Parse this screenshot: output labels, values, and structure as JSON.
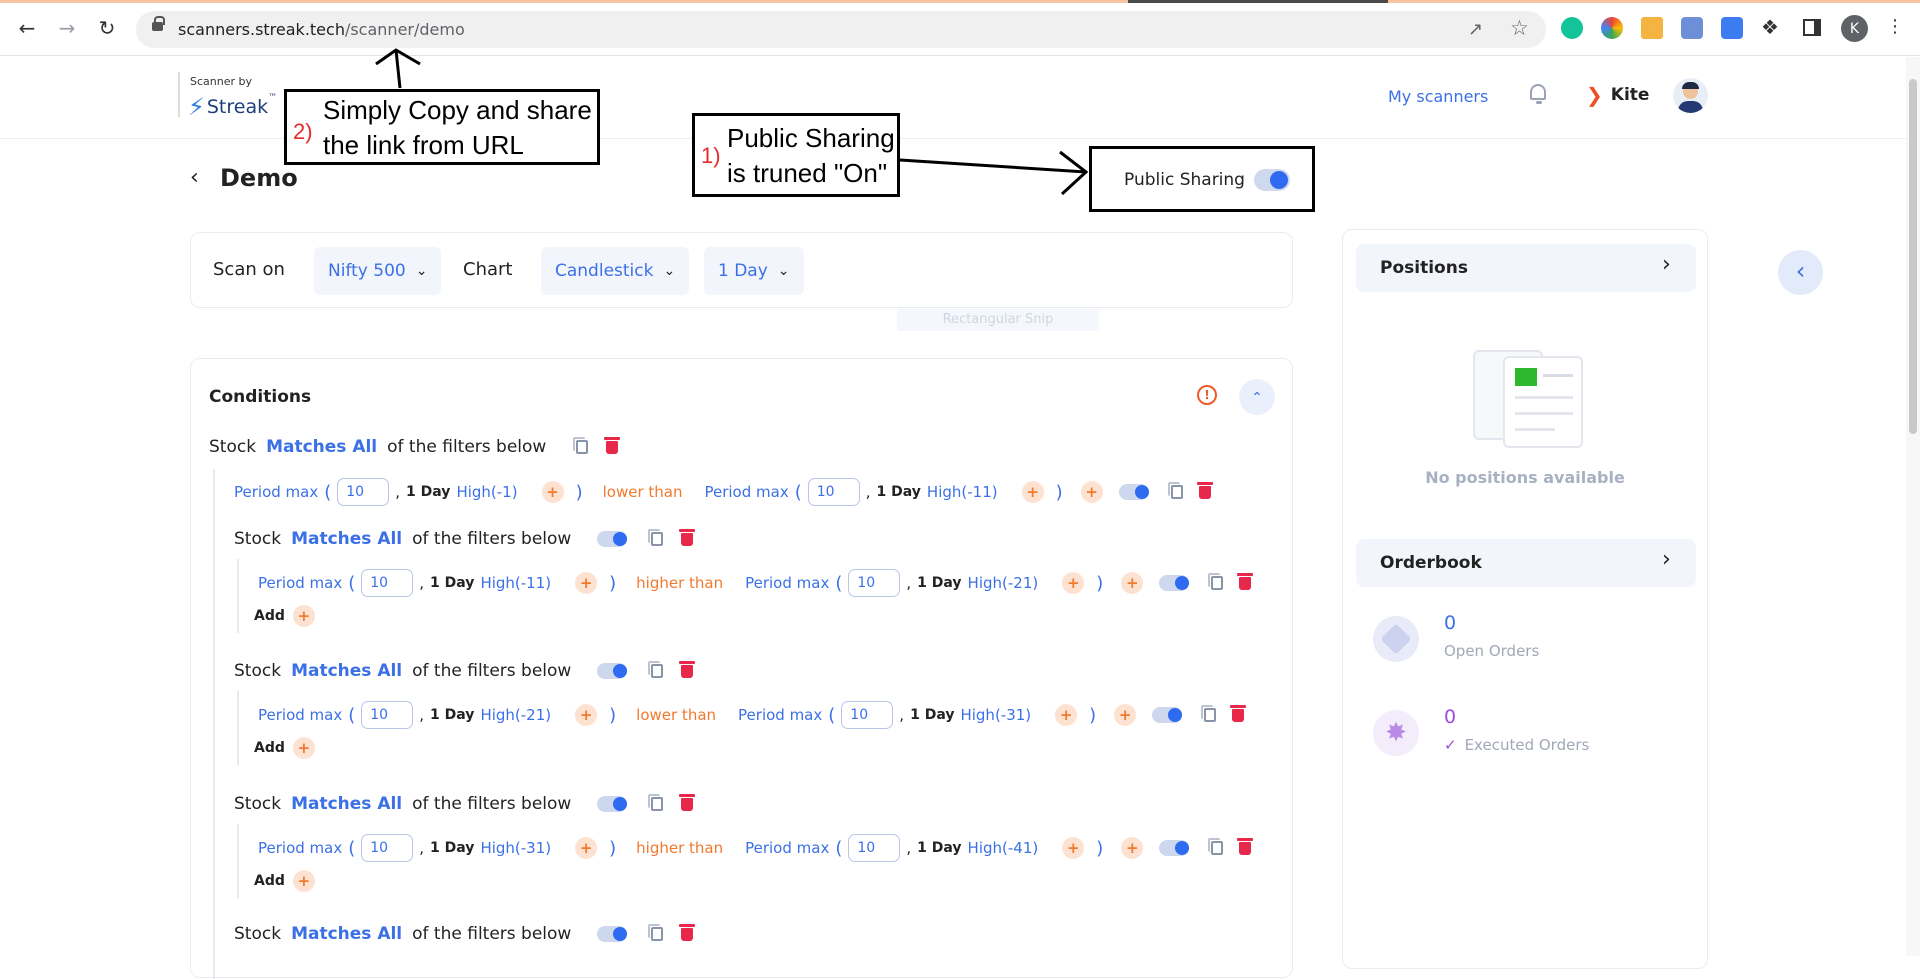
{
  "browser": {
    "url_host": "scanners.streak.tech",
    "url_path": "/scanner/demo",
    "profile_initial": "K"
  },
  "header": {
    "brand_small": "Scanner by",
    "brand_name": "Streak",
    "brand_tm": "™",
    "my_scanners": "My scanners",
    "kite_label": "Kite"
  },
  "page": {
    "title": "Demo",
    "public_sharing_label": "Public Sharing",
    "public_sharing_on": true
  },
  "scan_bar": {
    "scan_on_label": "Scan on",
    "scan_on_value": "Nifty 500",
    "chart_label": "Chart",
    "chart_type_value": "Candlestick",
    "timeframe_value": "1 Day",
    "snip_hint": "Rectangular Snip"
  },
  "conditions": {
    "title": "Conditions",
    "root_prefix": "Stock",
    "root_match": "Matches All",
    "root_suffix": "of the filters below",
    "top_row": {
      "left_fn": "Period max",
      "left_val": "10",
      "left_tf": "1 Day",
      "left_field": "High(-1)",
      "op": "lower than",
      "right_fn": "Period max",
      "right_val": "10",
      "right_tf": "1 Day",
      "right_field": "High(-11)"
    },
    "groups": [
      {
        "prefix": "Stock",
        "match": "Matches All",
        "suffix": "of the filters below",
        "left_fn": "Period max",
        "left_val": "10",
        "left_tf": "1 Day",
        "left_field": "High(-11)",
        "op": "higher than",
        "right_fn": "Period max",
        "right_val": "10",
        "right_tf": "1 Day",
        "right_field": "High(-21)",
        "add_label": "Add"
      },
      {
        "prefix": "Stock",
        "match": "Matches All",
        "suffix": "of the filters below",
        "left_fn": "Period max",
        "left_val": "10",
        "left_tf": "1 Day",
        "left_field": "High(-21)",
        "op": "lower than",
        "right_fn": "Period max",
        "right_val": "10",
        "right_tf": "1 Day",
        "right_field": "High(-31)",
        "add_label": "Add"
      },
      {
        "prefix": "Stock",
        "match": "Matches All",
        "suffix": "of the filters below",
        "left_fn": "Period max",
        "left_val": "10",
        "left_tf": "1 Day",
        "left_field": "High(-31)",
        "op": "higher than",
        "right_fn": "Period max",
        "right_val": "10",
        "right_tf": "1 Day",
        "right_field": "High(-41)",
        "add_label": "Add"
      }
    ],
    "last_group": {
      "prefix": "Stock",
      "match": "Matches All",
      "suffix": "of the filters below"
    }
  },
  "sidebar": {
    "positions_title": "Positions",
    "no_positions": "No positions available",
    "orderbook_title": "Orderbook",
    "open_orders_count": "0",
    "open_orders_label": "Open Orders",
    "executed_orders_count": "0",
    "executed_orders_label": "Executed Orders"
  },
  "annotations": {
    "a1_number": "1)",
    "a1_line1": "Public Sharing",
    "a1_line2": "is truned \"On\"",
    "a2_number": "2)",
    "a2_line1": "Simply Copy and share",
    "a2_line2": "the link from URL"
  },
  "colors": {
    "accent_blue": "#3b70e6",
    "accent_orange": "#f07a2e",
    "delete_red": "#e8284a",
    "annotation_red": "#e52b2b"
  }
}
